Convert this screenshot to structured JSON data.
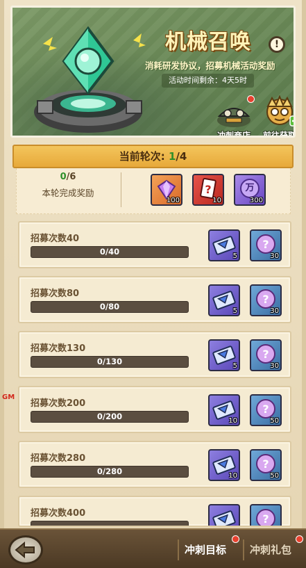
{
  "banner": {
    "title": "机械召唤",
    "info_icon": "!",
    "description": "消耗研发协议，招募机械活动奖励",
    "time_label": "活动时间剩余：",
    "time_value": "4天5时",
    "shop_label": "冲刺商店",
    "go_label": "前往获取"
  },
  "round": {
    "label": "当前轮次: ",
    "current": "1",
    "total": "/4",
    "progress_current": "0",
    "progress_total": "/6",
    "reward_label": "本轮完成奖励",
    "rewards": [
      {
        "icon": "diamond-icon",
        "count": "100",
        "style": "orange"
      },
      {
        "icon": "mystery-card-icon",
        "count": "10",
        "style": "red"
      },
      {
        "icon": "coin-icon",
        "symbol": "万",
        "count": "300",
        "style": "purple"
      }
    ]
  },
  "tasks": [
    {
      "title": "招募次数40",
      "progress_text": "0/40",
      "progress": 0,
      "reward1": "5",
      "reward2": "30"
    },
    {
      "title": "招募次数80",
      "progress_text": "0/80",
      "progress": 0,
      "reward1": "5",
      "reward2": "30"
    },
    {
      "title": "招募次数130",
      "progress_text": "0/130",
      "progress": 0,
      "reward1": "5",
      "reward2": "30"
    },
    {
      "title": "招募次数200",
      "progress_text": "0/200",
      "progress": 0,
      "reward1": "10",
      "reward2": "50"
    },
    {
      "title": "招募次数280",
      "progress_text": "0/280",
      "progress": 0,
      "reward1": "10",
      "reward2": "50"
    },
    {
      "title": "招募次数400",
      "progress_text": "",
      "progress": 0,
      "reward1": "",
      "reward2": ""
    }
  ],
  "gm_tag": "GM",
  "bottom": {
    "back_icon": "back-arrow-icon",
    "tab_sprint_goal": "冲刺目标",
    "tab_sprint_pack": "冲刺礼包"
  },
  "colors": {
    "accent": "#e7a93a",
    "green": "#2f8f2a",
    "badge_red": "#e8412f"
  }
}
